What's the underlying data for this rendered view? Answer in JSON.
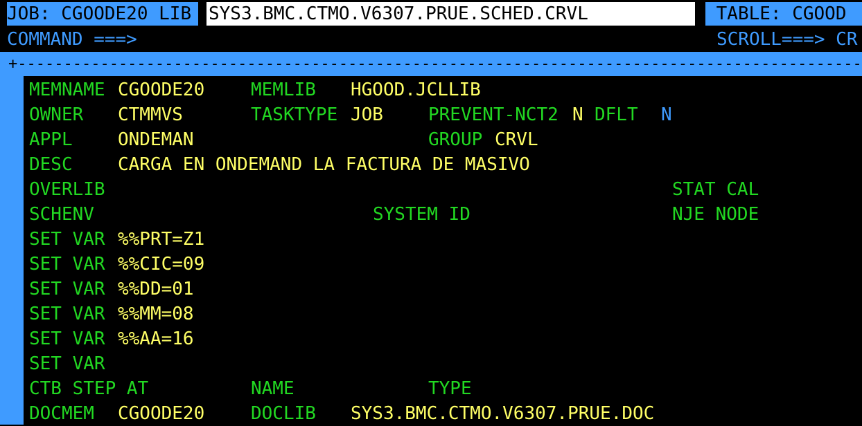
{
  "header": {
    "job_label": "JOB: CGOODE20 LIB ",
    "lib_value": "SYS3.BMC.CTMO.V6307.PRUE.SCHED.CRVL",
    "table_label": " TABLE: CGOOD",
    "command_label": "COMMAND ===>",
    "scroll_label": "SCROLL===> CR"
  },
  "frame": {
    "top_border": "+-----------------------------------------------------------------------------------------------------------------"
  },
  "fields": {
    "memname_label": "MEMNAME",
    "memname_value": "CGOODE20",
    "memlib_label": "MEMLIB",
    "memlib_value": "HGOOD.JCLLIB",
    "owner_label": "OWNER",
    "owner_value": "CTMMVS",
    "tasktype_label": "TASKTYPE",
    "tasktype_value": "JOB",
    "prevent_label": "PREVENT-NCT2",
    "prevent_value": "N",
    "dflt_label": "DFLT",
    "dflt_value": "N",
    "appl_label": "APPL",
    "appl_value": "ONDEMAN",
    "group_label": "GROUP",
    "group_value": "CRVL",
    "desc_label": "DESC",
    "desc_value": "CARGA EN ONDEMAND LA FACTURA DE MASIVO",
    "overlib_label": "OVERLIB",
    "statcal_label": "STAT CAL",
    "schenv_label": "SCHENV",
    "systemid_label": "SYSTEM ID",
    "njenode_label": "NJE NODE",
    "setvar_label": "SET VAR",
    "setvars": [
      "%%PRT=Z1",
      "%%CIC=09",
      "%%DD=01",
      "%%MM=08",
      "%%AA=16",
      ""
    ],
    "ctb_label": "CTB STEP AT",
    "name_label": "NAME",
    "type_label": "TYPE",
    "docmem_label": "DOCMEM",
    "docmem_value": "CGOODE20",
    "doclib_label": "DOCLIB",
    "doclib_value": "SYS3.BMC.CTMO.V6307.PRUE.DOC"
  }
}
